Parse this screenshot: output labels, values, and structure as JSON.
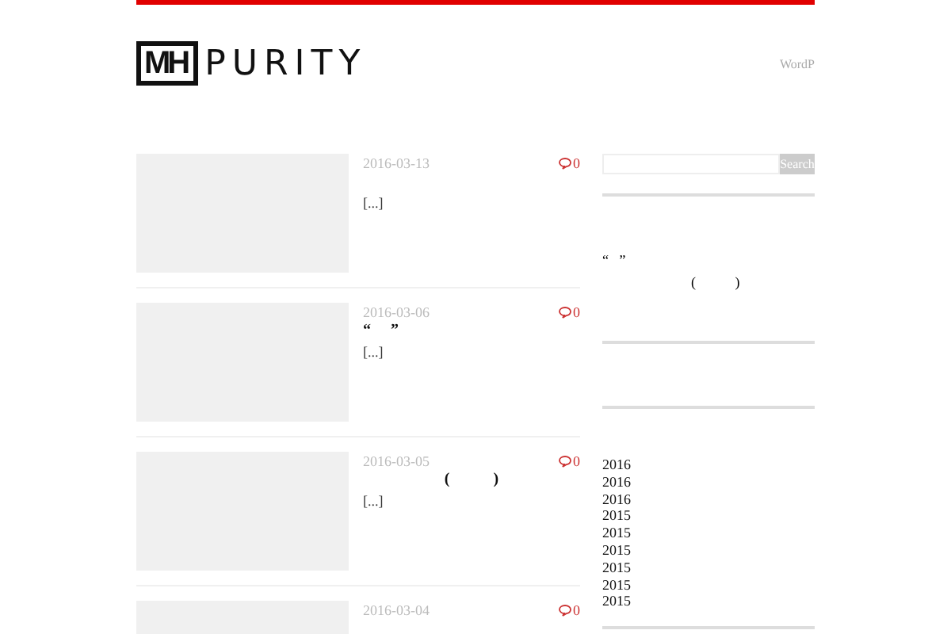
{
  "header": {
    "logo_mark": "MH",
    "logo_text": "PURITY",
    "nav_item": "WordP"
  },
  "posts": [
    {
      "date": "2016-03-13",
      "comments": "0",
      "excerpt": "[...]"
    },
    {
      "date": "2016-03-06",
      "comments": "0",
      "title": "“     ”",
      "excerpt": "[...]"
    },
    {
      "date": "2016-03-05",
      "comments": "0",
      "title": "(           )",
      "excerpt": "[...]"
    },
    {
      "date": "2016-03-04",
      "comments": "0"
    }
  ],
  "sidebar": {
    "search": {
      "button": "Search"
    },
    "recent": [
      {
        "line_1": "“   ”",
        "line_2": "(           )"
      }
    ],
    "archives": [
      "2016",
      "2016",
      "2016",
      "2015",
      "2015",
      "2015",
      "2015",
      "2015",
      "2015"
    ]
  }
}
